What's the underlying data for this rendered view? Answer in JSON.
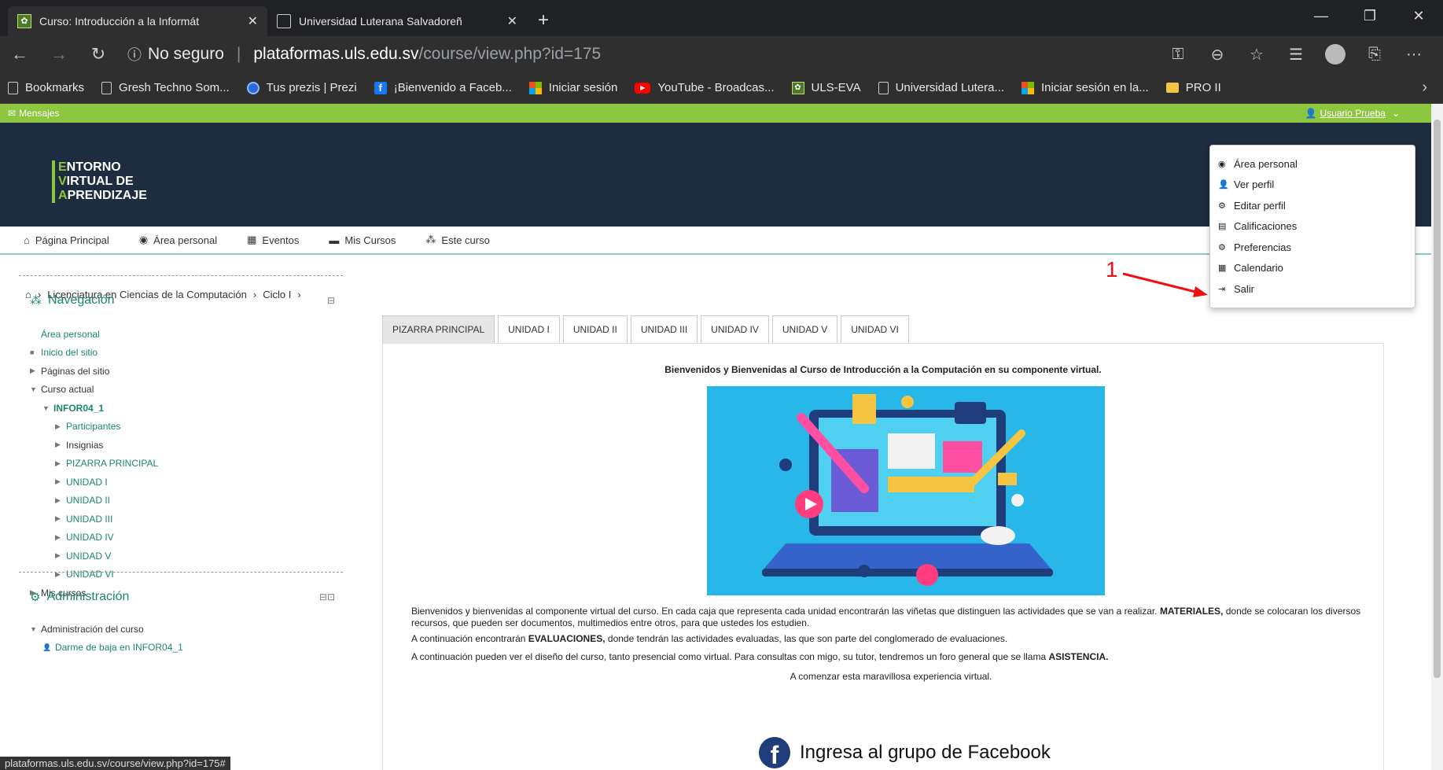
{
  "browser": {
    "tabs": [
      {
        "title": "Curso: Introducción a la Informát",
        "active": true
      },
      {
        "title": "Universidad Luterana Salvadoreñ",
        "active": false
      }
    ],
    "new_tab": "+",
    "window_controls": [
      "—",
      "❐",
      "✕"
    ],
    "address": {
      "security": "No seguro",
      "domain": "plataformas.uls.edu.sv",
      "path": "/course/view.php?id=175"
    },
    "bookmarks": [
      {
        "label": "Bookmarks",
        "icon": "document-icon"
      },
      {
        "label": "Gresh Techno Som...",
        "icon": "document-icon"
      },
      {
        "label": "Tus prezis | Prezi",
        "icon": "prezi-icon"
      },
      {
        "label": "¡Bienvenido a Faceb...",
        "icon": "facebook-icon"
      },
      {
        "label": "Iniciar sesión",
        "icon": "microsoft-icon"
      },
      {
        "label": "YouTube - Broadcas...",
        "icon": "youtube-icon"
      },
      {
        "label": "ULS-EVA",
        "icon": "uls-icon"
      },
      {
        "label": "Universidad Lutera...",
        "icon": "document-icon"
      },
      {
        "label": "Iniciar sesión en la...",
        "icon": "microsoft-icon"
      },
      {
        "label": "PRO II",
        "icon": "folder-icon"
      }
    ],
    "status_url": "plataformas.uls.edu.sv/course/view.php?id=175#"
  },
  "topbar": {
    "messages": "Mensajes",
    "user": "Usuario Prueba"
  },
  "logo": {
    "line1_initial": "E",
    "line1_rest": "NTORNO",
    "line2_initial": "V",
    "line2_rest": "IRTUAL DE",
    "line3_initial": "A",
    "line3_rest": "PRENDIZAJE"
  },
  "mainnav": [
    {
      "label": "Página Principal",
      "icon": "home-icon"
    },
    {
      "label": "Área personal",
      "icon": "dashboard-icon"
    },
    {
      "label": "Eventos",
      "icon": "calendar-icon"
    },
    {
      "label": "Mis Cursos",
      "icon": "briefcase-icon"
    },
    {
      "label": "Este curso",
      "icon": "sitemap-icon"
    }
  ],
  "breadcrumb": [
    "Licenciatura en Ciencias de la Computación",
    "Ciclo I"
  ],
  "navigation": {
    "title": "Navegación",
    "items": [
      {
        "label": "Área personal",
        "level": 0,
        "twisty": "",
        "style": "link"
      },
      {
        "label": "Inicio del sitio",
        "level": 0,
        "twisty": "■",
        "style": "link"
      },
      {
        "label": "Páginas del sitio",
        "level": 0,
        "twisty": "▶",
        "style": "dark"
      },
      {
        "label": "Curso actual",
        "level": 0,
        "twisty": "▼",
        "style": "dark"
      },
      {
        "label": "INFOR04_1",
        "level": 1,
        "twisty": "▼",
        "style": "bold"
      },
      {
        "label": "Participantes",
        "level": 2,
        "twisty": "▶",
        "style": "link"
      },
      {
        "label": "Insignias",
        "level": 2,
        "twisty": "▶",
        "style": "dark"
      },
      {
        "label": "PIZARRA PRINCIPAL",
        "level": 2,
        "twisty": "▶",
        "style": "link"
      },
      {
        "label": "UNIDAD I",
        "level": 2,
        "twisty": "▶",
        "style": "link"
      },
      {
        "label": "UNIDAD II",
        "level": 2,
        "twisty": "▶",
        "style": "link"
      },
      {
        "label": "UNIDAD III",
        "level": 2,
        "twisty": "▶",
        "style": "link"
      },
      {
        "label": "UNIDAD IV",
        "level": 2,
        "twisty": "▶",
        "style": "link"
      },
      {
        "label": "UNIDAD V",
        "level": 2,
        "twisty": "▶",
        "style": "link"
      },
      {
        "label": "UNIDAD VI",
        "level": 2,
        "twisty": "▶",
        "style": "link"
      },
      {
        "label": "Mis cursos",
        "level": 0,
        "twisty": "▶",
        "style": "dark"
      }
    ]
  },
  "administration": {
    "title": "Administración",
    "items": [
      {
        "label": "Administración del curso",
        "twisty": "▼"
      },
      {
        "label": "Darme de baja en INFOR04_1",
        "twisty": "user"
      }
    ]
  },
  "course_tabs": [
    "PIZARRA PRINCIPAL",
    "UNIDAD I",
    "UNIDAD II",
    "UNIDAD III",
    "UNIDAD IV",
    "UNIDAD V",
    "UNIDAD VI"
  ],
  "content": {
    "heading": "Bienvenidos y Bienvenidas al Curso de Introducción a la Computación en su componente virtual.",
    "p1_a": "Bienvenidos y bienvenidas al componente virtual del curso. En cada caja que representa cada unidad encontrarán las viñetas que distinguen las actividades que se van a realizar. ",
    "p1_b": "MATERIALES,",
    "p1_c": " donde se colocaran los diversos recursos, que pueden ser documentos, multimedios entre otros, para que ustedes los estudien.",
    "p2_a": "A continuación encontrarán ",
    "p2_b": "EVALUACIONES,",
    "p2_c": " donde tendrán las actividades evaluadas, las que son parte del conglomerado de evaluaciones.",
    "p3_a": "A continuación pueden ver el diseño del curso, tanto presencial como virtual. Para consultas con migo, su tutor, tendremos un foro general que se llama ",
    "p3_b": "ASISTENCIA.",
    "p4": "A comenzar esta maravillosa experiencia virtual.",
    "facebook": "Ingresa al grupo de Facebook"
  },
  "user_menu": [
    {
      "label": "Área personal",
      "icon": "dashboard-icon"
    },
    {
      "label": "Ver perfil",
      "icon": "user-icon"
    },
    {
      "label": "Editar perfil",
      "icon": "cog-icon"
    },
    {
      "label": "Calificaciones",
      "icon": "table-icon"
    },
    {
      "label": "Preferencias",
      "icon": "wrench-icon"
    },
    {
      "label": "Calendario",
      "icon": "calendar-icon"
    },
    {
      "label": "Salir",
      "icon": "sign-out-icon"
    }
  ],
  "annotation": "1",
  "colors": {
    "accent_green": "#8dc63f",
    "header_navy": "#1e2c3f",
    "link": "#1a8a5e",
    "annotation": "#ee1111"
  }
}
